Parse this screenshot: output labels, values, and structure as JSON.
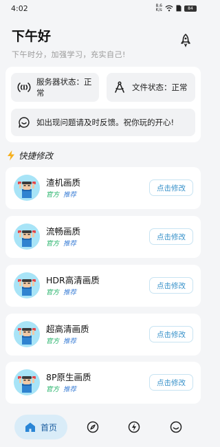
{
  "status_bar": {
    "time": "4:02",
    "net_speed_value": "8.6",
    "net_speed_unit": "K/s",
    "battery": "84"
  },
  "header": {
    "title": "下午好",
    "subtitle": "下午时分，加强学习，充实自己!"
  },
  "status_panel": {
    "server_status": "服务器状态：正常",
    "file_status": "文件状态：正常",
    "feedback": "如出现问题请及时反馈。祝你玩的开心!"
  },
  "section": {
    "title": "快捷修改"
  },
  "qualities": [
    {
      "name": "渣机画质",
      "tag1": "官方",
      "tag2": "推荐",
      "button": "点击修改"
    },
    {
      "name": "流畅画质",
      "tag1": "官方",
      "tag2": "推荐",
      "button": "点击修改"
    },
    {
      "name": "HDR高清画质",
      "tag1": "官方",
      "tag2": "推荐",
      "button": "点击修改"
    },
    {
      "name": "超高清画质",
      "tag1": "官方",
      "tag2": "推荐",
      "button": "点击修改"
    },
    {
      "name": "8P原生画质",
      "tag1": "官方",
      "tag2": "推荐",
      "button": "点击修改"
    }
  ],
  "nav": {
    "home_label": "首页",
    "icons": [
      "home-icon",
      "compass-icon",
      "lightning-icon",
      "smile-icon"
    ]
  },
  "colors": {
    "accent": "#3590c9",
    "tag_official": "#25b36a",
    "tag_recommend": "#3c7fd6",
    "nav_active_bg": "#d9ecf8"
  }
}
